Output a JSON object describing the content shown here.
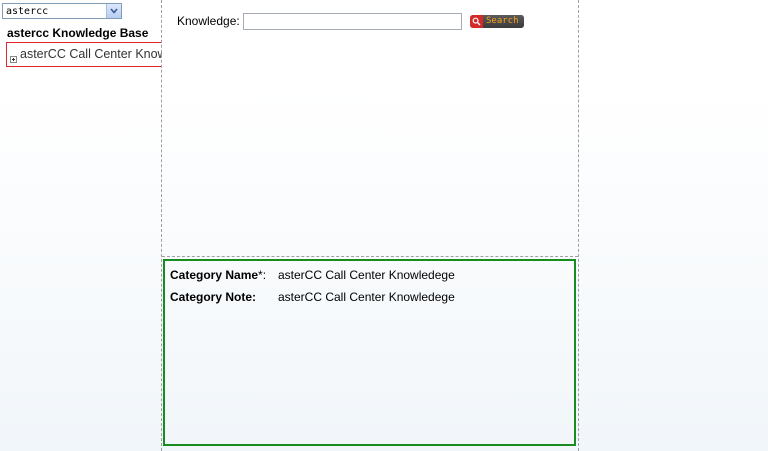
{
  "sidebar": {
    "kb_select": {
      "selected": "astercc"
    },
    "title": "astercc Knowledge Base",
    "tree": [
      {
        "label": "asterCC Call Center Knowledege",
        "expand_symbol": "+"
      }
    ]
  },
  "search": {
    "label": "Knowledge:",
    "value": "",
    "placeholder": "",
    "button_label": "Search"
  },
  "detail": {
    "category_name_label": "Category Name",
    "required_mark": "*:",
    "category_name_value": "asterCC Call Center Knowledege",
    "category_note_label": "Category Note:",
    "category_note_value": "asterCC Call Center Knowledege"
  },
  "colors": {
    "tree_border": "#e0282c",
    "detail_border": "#188c1e",
    "search_icon_bg": "#d52a2a",
    "search_text": "#f6a21a"
  }
}
